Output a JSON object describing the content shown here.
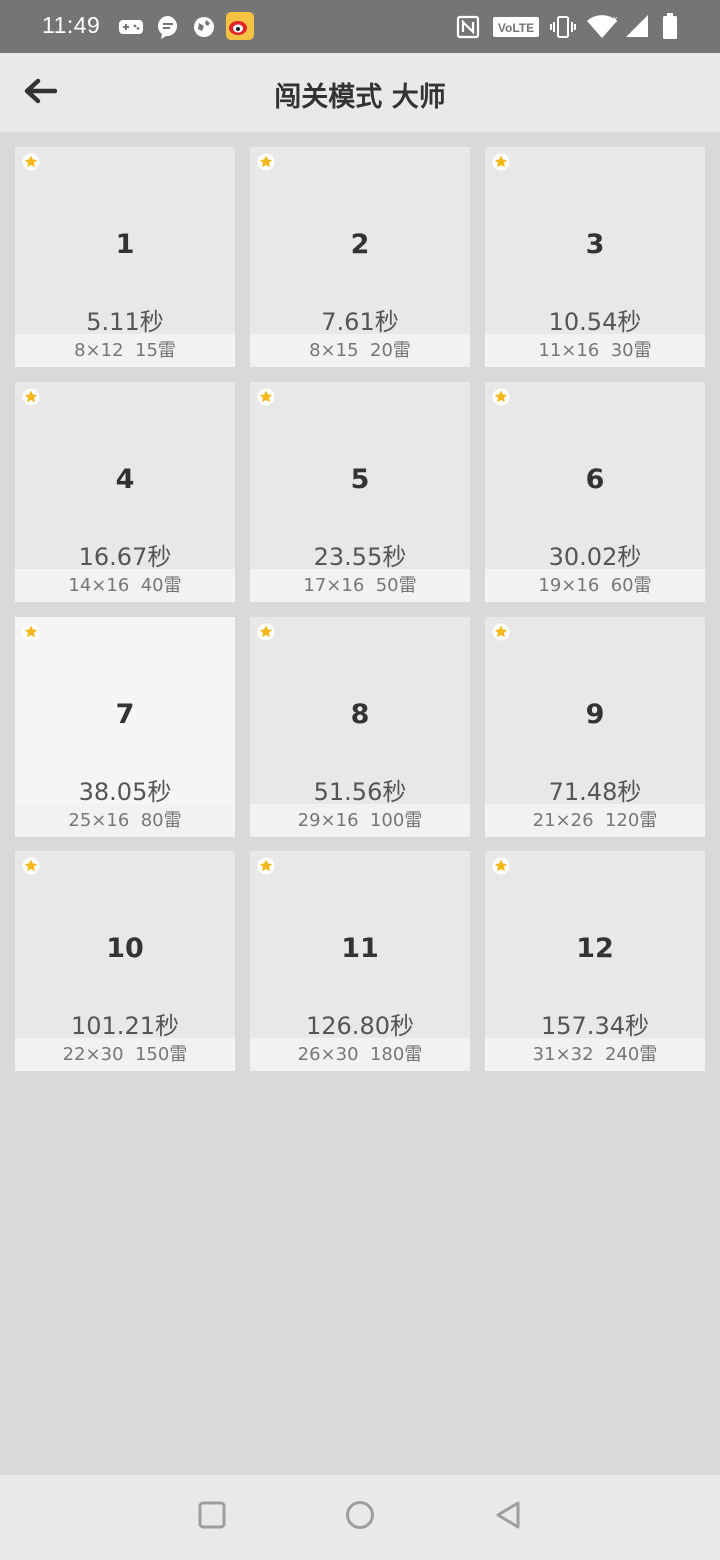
{
  "status_bar": {
    "time": "11:49",
    "left_icons": [
      "gamepad-icon",
      "chat-icon",
      "globe-icon",
      "weibo-icon"
    ],
    "volte_label": "VoLTE",
    "right_icons": [
      "nfc-icon",
      "volte-icon",
      "vibrate-icon",
      "wifi-icon",
      "signal-icon",
      "battery-icon"
    ]
  },
  "header": {
    "title": "闯关模式 大师",
    "back_icon": "back-arrow-icon"
  },
  "levels": [
    {
      "number": "1",
      "time": "5.11秒",
      "size": "8×12",
      "mines": "15雷"
    },
    {
      "number": "2",
      "time": "7.61秒",
      "size": "8×15",
      "mines": "20雷"
    },
    {
      "number": "3",
      "time": "10.54秒",
      "size": "11×16",
      "mines": "30雷"
    },
    {
      "number": "4",
      "time": "16.67秒",
      "size": "14×16",
      "mines": "40雷"
    },
    {
      "number": "5",
      "time": "23.55秒",
      "size": "17×16",
      "mines": "50雷"
    },
    {
      "number": "6",
      "time": "30.02秒",
      "size": "19×16",
      "mines": "60雷"
    },
    {
      "number": "7",
      "time": "38.05秒",
      "size": "25×16",
      "mines": "80雷"
    },
    {
      "number": "8",
      "time": "51.56秒",
      "size": "29×16",
      "mines": "100雷"
    },
    {
      "number": "9",
      "time": "71.48秒",
      "size": "21×26",
      "mines": "120雷"
    },
    {
      "number": "10",
      "time": "101.21秒",
      "size": "22×30",
      "mines": "150雷"
    },
    {
      "number": "11",
      "time": "126.80秒",
      "size": "26×30",
      "mines": "180雷"
    },
    {
      "number": "12",
      "time": "157.34秒",
      "size": "31×32",
      "mines": "240雷"
    }
  ],
  "nav_bar": {
    "icons": [
      "recents-square-icon",
      "home-circle-icon",
      "back-triangle-icon"
    ]
  },
  "colors": {
    "star": "#f5b81c",
    "card": "#e8e8e8",
    "card_highlight": "#f5f5f5",
    "background": "#d9d9d9"
  }
}
